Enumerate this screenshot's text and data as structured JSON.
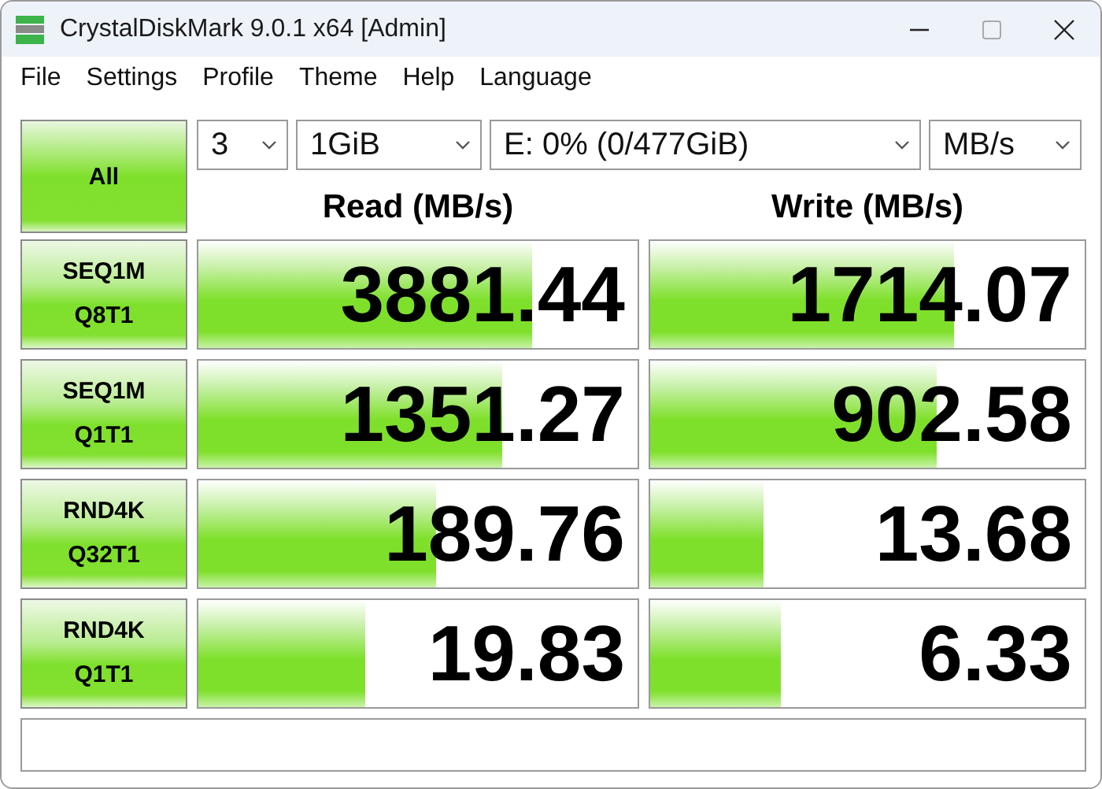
{
  "window": {
    "title": "CrystalDiskMark 9.0.1 x64 [Admin]"
  },
  "menu": [
    "File",
    "Settings",
    "Profile",
    "Theme",
    "Help",
    "Language"
  ],
  "all_button": "All",
  "selectors": [
    {
      "value": "3"
    },
    {
      "value": "1GiB"
    },
    {
      "value": "E: 0% (0/477GiB)"
    },
    {
      "value": "MB/s"
    }
  ],
  "headers": [
    "Read (MB/s)",
    "Write (MB/s)"
  ],
  "rows": [
    {
      "test": "SEQ1M",
      "params": "Q8T1",
      "read": {
        "value": "3881.44",
        "level": 0.76
      },
      "write": {
        "value": "1714.07",
        "level": 0.7
      }
    },
    {
      "test": "SEQ1M",
      "params": "Q1T1",
      "read": {
        "value": "1351.27",
        "level": 0.69
      },
      "write": {
        "value": "902.58",
        "level": 0.66
      }
    },
    {
      "test": "RND4K",
      "params": "Q32T1",
      "read": {
        "value": "189.76",
        "level": 0.54
      },
      "write": {
        "value": "13.68",
        "level": 0.26
      }
    },
    {
      "test": "RND4K",
      "params": "Q1T1",
      "read": {
        "value": "19.83",
        "level": 0.38
      },
      "write": {
        "value": "6.33",
        "level": 0.3
      }
    }
  ]
}
